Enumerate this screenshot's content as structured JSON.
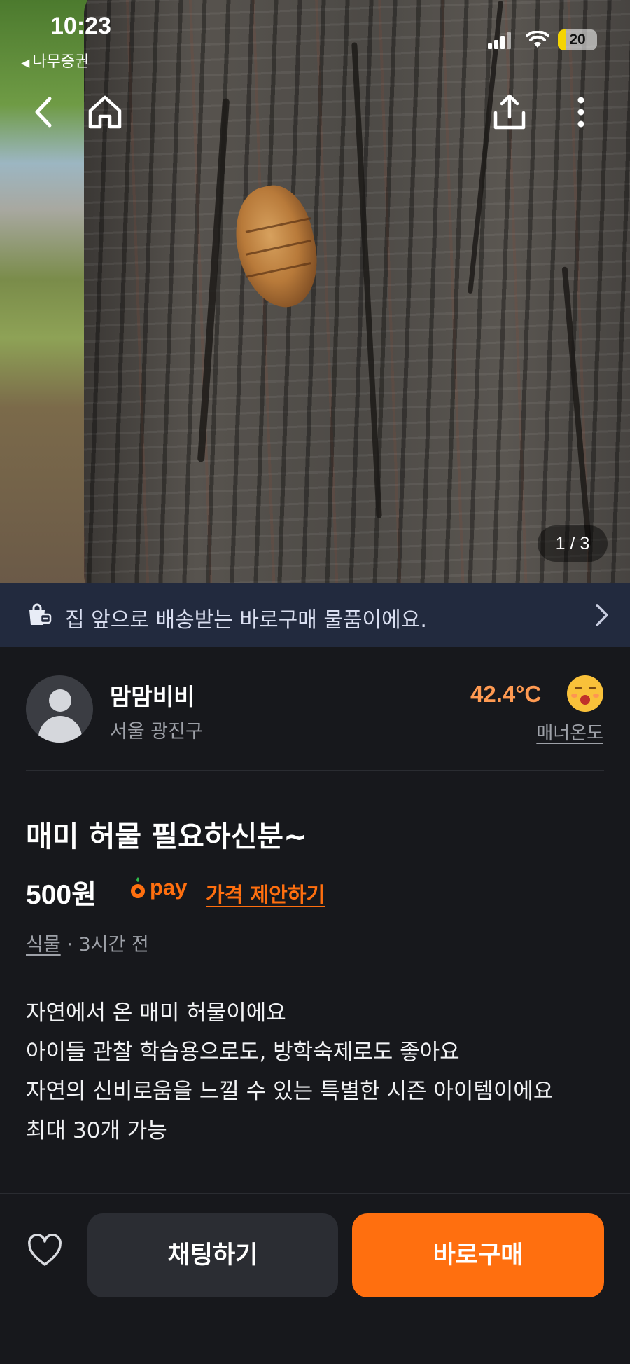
{
  "status_bar": {
    "time": "10:23",
    "back_app": "나무증권",
    "battery": "20"
  },
  "gallery": {
    "counter": "1 / 3"
  },
  "banner": {
    "text": "집 앞으로 배송받는 바로구매 물품이에요."
  },
  "seller": {
    "name": "맘맘비비",
    "location": "서울 광진구",
    "temperature": "42.4°C",
    "manner_label": "매너온도"
  },
  "product": {
    "title": "매미 허물 필요하신분~",
    "price": "500원",
    "pay_label": "pay",
    "offer_label": "가격 제안하기",
    "category": "식물",
    "posted": "· 3시간 전",
    "description": [
      "자연에서 온 매미 허물이에요",
      "아이들 관찰 학습용으로도, 방학숙제로도 좋아요",
      "자연의 신비로움을 느낄 수 있는 특별한 시즌 아이템이에요",
      "최대 30개 가능"
    ]
  },
  "actions": {
    "chat": "채팅하기",
    "buy": "바로구매"
  },
  "colors": {
    "accent": "#ff6f0f",
    "temperature": "#ff9a52",
    "banner_bg": "#222a3e",
    "background": "#17181c"
  },
  "icons": [
    "back-arrow-icon",
    "home-icon",
    "share-icon",
    "more-icon",
    "shopping-bag-icon",
    "chevron-right-icon",
    "heart-icon",
    "carrot-pay-icon"
  ]
}
